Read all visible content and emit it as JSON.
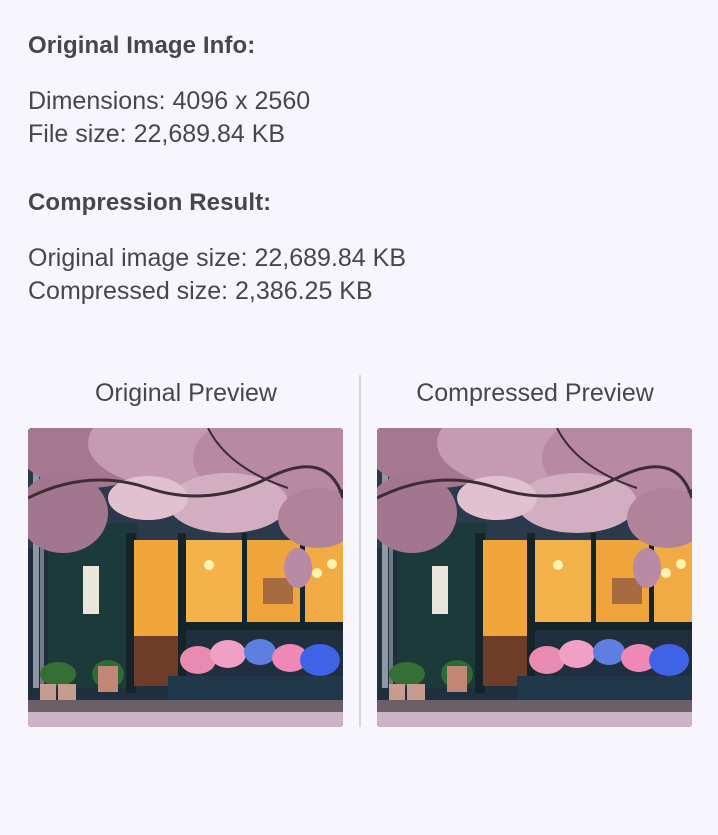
{
  "original_info": {
    "title": "Original Image Info:",
    "dimensions_label": "Dimensions:",
    "dimensions_value": "4096 x 2560",
    "file_size_label": "File size:",
    "file_size_value": "22,689.84 KB"
  },
  "compression_result": {
    "title": "Compression Result:",
    "original_size_label": "Original image size:",
    "original_size_value": "22,689.84 KB",
    "compressed_size_label": "Compressed size:",
    "compressed_size_value": "2,386.25 KB"
  },
  "previews": {
    "original_title": "Original Preview",
    "compressed_title": "Compressed Preview"
  }
}
